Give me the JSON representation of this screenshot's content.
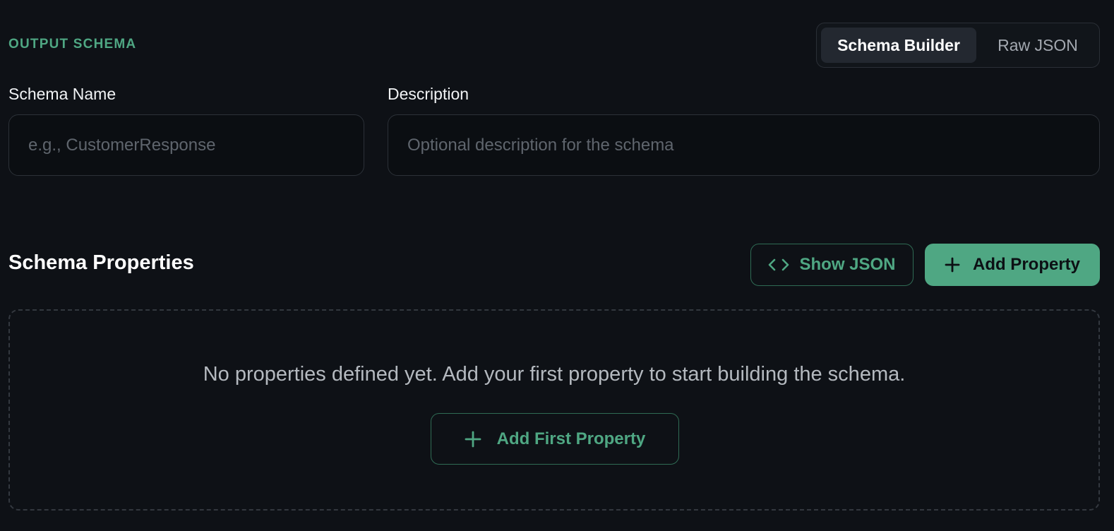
{
  "output_schema": {
    "section_label": "OUTPUT SCHEMA",
    "mode_toggle": {
      "active": "Schema Builder",
      "inactive": "Raw JSON"
    },
    "fields": {
      "name": {
        "label": "Schema Name",
        "value": "",
        "placeholder": "e.g., CustomerResponse"
      },
      "description": {
        "label": "Description",
        "value": "",
        "placeholder": "Optional description for the schema"
      }
    },
    "properties": {
      "title": "Schema Properties",
      "show_json_label": "Show JSON",
      "add_property_label": "Add Property",
      "empty_message": "No properties defined yet. Add your first property to start building the schema.",
      "add_first_label": "Add First Property"
    }
  },
  "icons": {
    "show_json": "code-icon",
    "add_property": "plus-icon",
    "add_first": "plus-icon"
  },
  "colors": {
    "accent": "#4fa783",
    "background": "#0e1116",
    "border": "#2c3138"
  }
}
